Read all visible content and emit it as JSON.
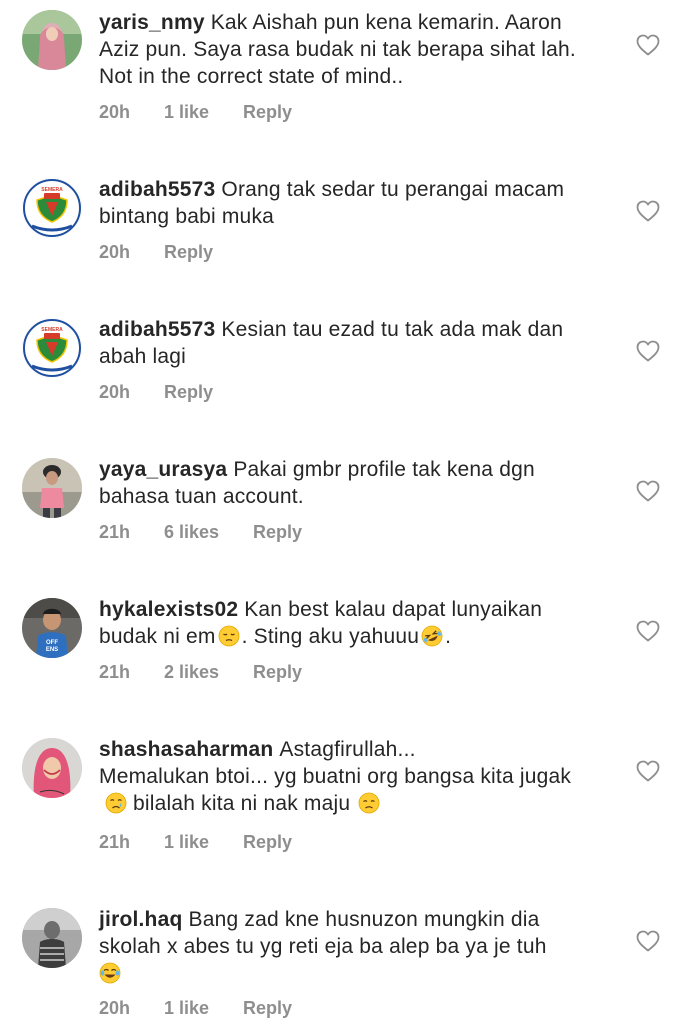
{
  "comments": [
    {
      "username": "yaris_nmy",
      "text": "Kak Aishah pun kena kemarin. Aaron Aziz pun. Saya rasa budak ni tak berapa sihat lah. Not in the correct state of mind..",
      "time": "20h",
      "likes": "1 like",
      "reply": "Reply"
    },
    {
      "username": "adibah5573",
      "text": "Orang tak sedar tu perangai macam bintang babi muka",
      "time": "20h",
      "likes": "",
      "reply": "Reply"
    },
    {
      "username": "adibah5573",
      "text": "Kesian tau ezad tu tak ada mak dan abah lagi",
      "time": "20h",
      "likes": "",
      "reply": "Reply"
    },
    {
      "username": "yaya_urasya",
      "text": "Pakai gmbr profile tak kena dgn bahasa tuan account.",
      "time": "21h",
      "likes": "6 likes",
      "reply": "Reply"
    },
    {
      "username": "hykalexists02",
      "text_parts": [
        "Kan best kalau dapat lunyaikan budak ni em",
        ". Sting aku yahuuu",
        "."
      ],
      "emoji": [
        "pensive-face-emoji",
        "rolling-laughing-emoji"
      ],
      "time": "21h",
      "likes": "2 likes",
      "reply": "Reply"
    },
    {
      "username": "shashasaharman",
      "text_parts": [
        "Astagfirullah...",
        "Memalukan btoi... yg buatni org bangsa kita jugak",
        "bilalah kita ni nak maju"
      ],
      "emoji": [
        "crying-face-emoji",
        "disappointed-face-emoji"
      ],
      "time": "21h",
      "likes": "1 like",
      "reply": "Reply"
    },
    {
      "username": "jirol.haq",
      "text": "Bang zad kne husnuzon mungkin dia skolah x abes tu yg reti eja ba alep ba ya je tuh",
      "emoji": [
        "tears-of-joy-emoji"
      ],
      "time": "20h",
      "likes": "1 like",
      "reply": "Reply"
    }
  ],
  "avatar_badge_text": "SEMERA",
  "avatar_shirt_text": [
    "OFF",
    "ENS"
  ],
  "colors": {
    "text": "#262626",
    "meta": "#8e8e8e",
    "heart": "#8e8e8e"
  }
}
